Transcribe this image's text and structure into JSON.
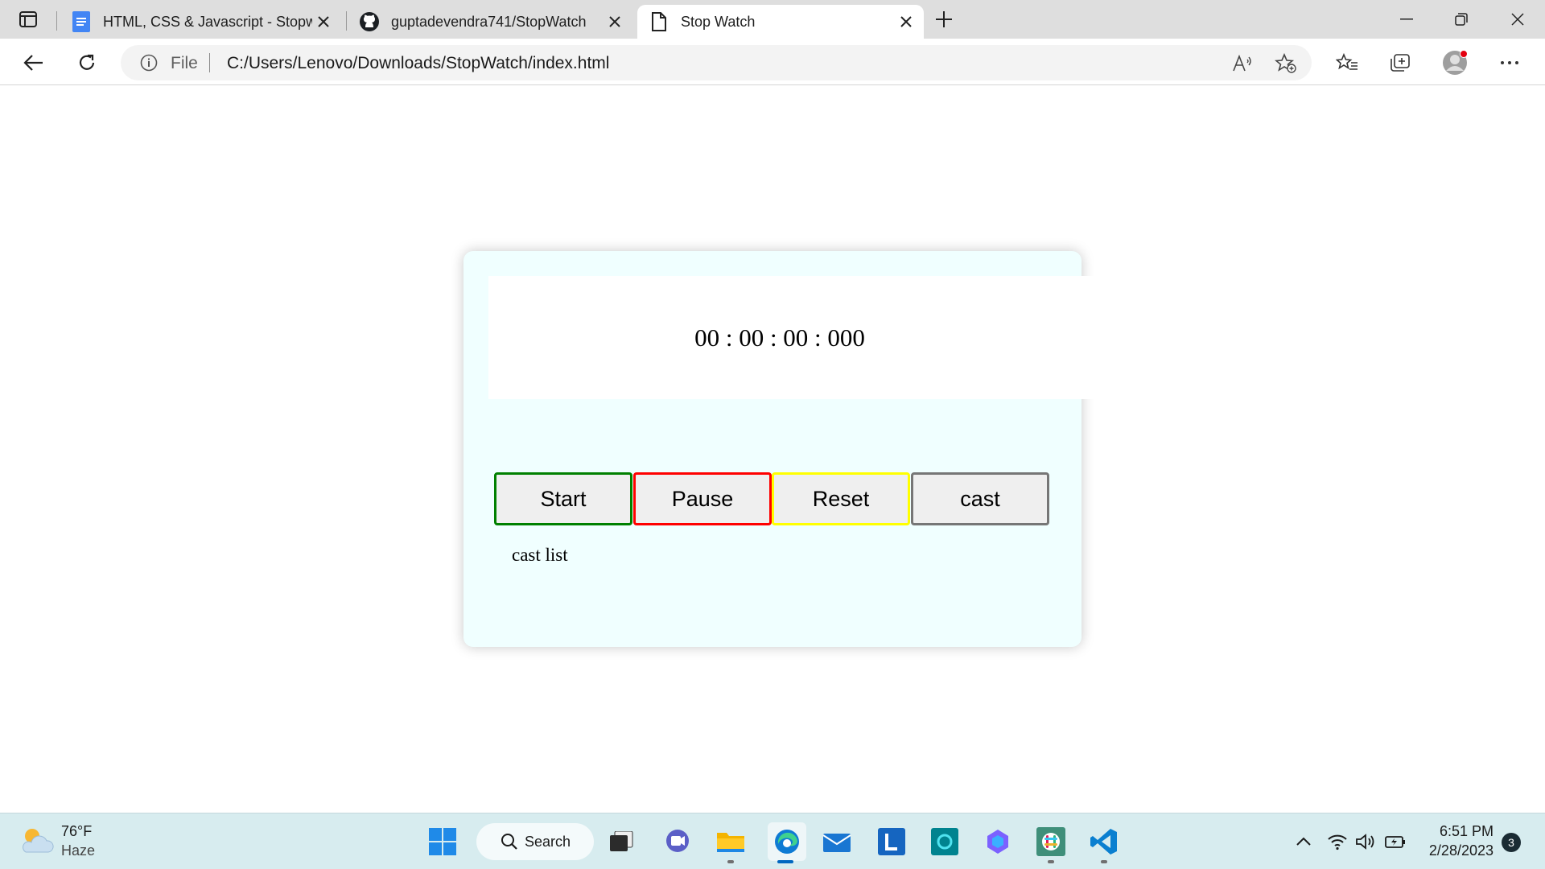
{
  "browser": {
    "tabs": [
      {
        "title": "HTML, CSS & Javascript - Stopwa",
        "favicon": "docs-icon"
      },
      {
        "title": "guptadevendra741/StopWatch",
        "favicon": "github-icon"
      },
      {
        "title": "Stop Watch",
        "favicon": "page-icon",
        "active": true
      }
    ],
    "address": {
      "scheme_label": "File",
      "url": "C:/Users/Lenovo/Downloads/StopWatch/index.html"
    }
  },
  "stopwatch": {
    "display": "00 : 00 : 00 : 000",
    "buttons": {
      "start": "Start",
      "pause": "Pause",
      "reset": "Reset",
      "cast": "cast"
    },
    "button_colors": {
      "start": "#008000",
      "pause": "#ff0000",
      "reset": "#ffff00",
      "cast": "#767676"
    },
    "cast_list_label": "cast list",
    "card_background": "#f0ffff"
  },
  "taskbar": {
    "weather": {
      "temp": "76°F",
      "condition": "Haze"
    },
    "search_label": "Search",
    "clock": {
      "time": "6:51 PM",
      "date": "2/28/2023"
    },
    "notification_count": "3"
  }
}
